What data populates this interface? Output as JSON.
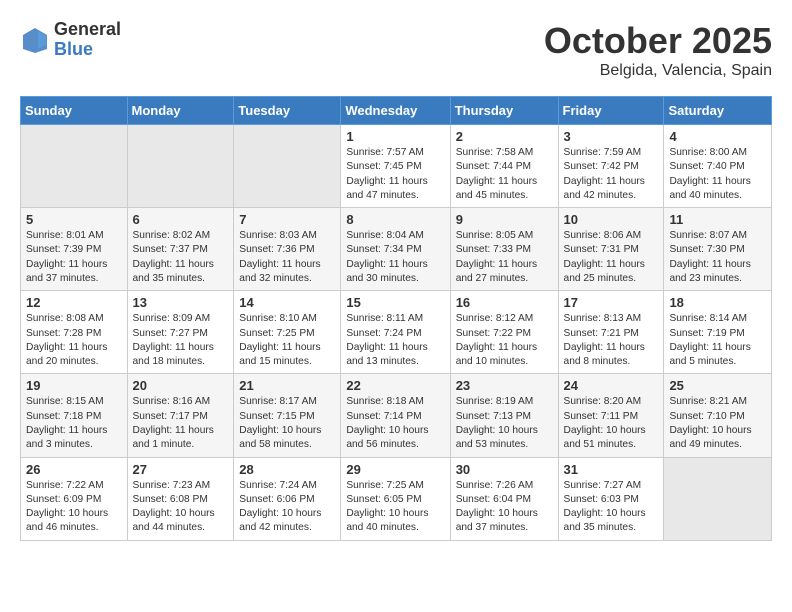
{
  "header": {
    "logo_general": "General",
    "logo_blue": "Blue",
    "month": "October 2025",
    "location": "Belgida, Valencia, Spain"
  },
  "weekdays": [
    "Sunday",
    "Monday",
    "Tuesday",
    "Wednesday",
    "Thursday",
    "Friday",
    "Saturday"
  ],
  "weeks": [
    [
      {
        "day": "",
        "info": ""
      },
      {
        "day": "",
        "info": ""
      },
      {
        "day": "",
        "info": ""
      },
      {
        "day": "1",
        "info": "Sunrise: 7:57 AM\nSunset: 7:45 PM\nDaylight: 11 hours and 47 minutes."
      },
      {
        "day": "2",
        "info": "Sunrise: 7:58 AM\nSunset: 7:44 PM\nDaylight: 11 hours and 45 minutes."
      },
      {
        "day": "3",
        "info": "Sunrise: 7:59 AM\nSunset: 7:42 PM\nDaylight: 11 hours and 42 minutes."
      },
      {
        "day": "4",
        "info": "Sunrise: 8:00 AM\nSunset: 7:40 PM\nDaylight: 11 hours and 40 minutes."
      }
    ],
    [
      {
        "day": "5",
        "info": "Sunrise: 8:01 AM\nSunset: 7:39 PM\nDaylight: 11 hours and 37 minutes."
      },
      {
        "day": "6",
        "info": "Sunrise: 8:02 AM\nSunset: 7:37 PM\nDaylight: 11 hours and 35 minutes."
      },
      {
        "day": "7",
        "info": "Sunrise: 8:03 AM\nSunset: 7:36 PM\nDaylight: 11 hours and 32 minutes."
      },
      {
        "day": "8",
        "info": "Sunrise: 8:04 AM\nSunset: 7:34 PM\nDaylight: 11 hours and 30 minutes."
      },
      {
        "day": "9",
        "info": "Sunrise: 8:05 AM\nSunset: 7:33 PM\nDaylight: 11 hours and 27 minutes."
      },
      {
        "day": "10",
        "info": "Sunrise: 8:06 AM\nSunset: 7:31 PM\nDaylight: 11 hours and 25 minutes."
      },
      {
        "day": "11",
        "info": "Sunrise: 8:07 AM\nSunset: 7:30 PM\nDaylight: 11 hours and 23 minutes."
      }
    ],
    [
      {
        "day": "12",
        "info": "Sunrise: 8:08 AM\nSunset: 7:28 PM\nDaylight: 11 hours and 20 minutes."
      },
      {
        "day": "13",
        "info": "Sunrise: 8:09 AM\nSunset: 7:27 PM\nDaylight: 11 hours and 18 minutes."
      },
      {
        "day": "14",
        "info": "Sunrise: 8:10 AM\nSunset: 7:25 PM\nDaylight: 11 hours and 15 minutes."
      },
      {
        "day": "15",
        "info": "Sunrise: 8:11 AM\nSunset: 7:24 PM\nDaylight: 11 hours and 13 minutes."
      },
      {
        "day": "16",
        "info": "Sunrise: 8:12 AM\nSunset: 7:22 PM\nDaylight: 11 hours and 10 minutes."
      },
      {
        "day": "17",
        "info": "Sunrise: 8:13 AM\nSunset: 7:21 PM\nDaylight: 11 hours and 8 minutes."
      },
      {
        "day": "18",
        "info": "Sunrise: 8:14 AM\nSunset: 7:19 PM\nDaylight: 11 hours and 5 minutes."
      }
    ],
    [
      {
        "day": "19",
        "info": "Sunrise: 8:15 AM\nSunset: 7:18 PM\nDaylight: 11 hours and 3 minutes."
      },
      {
        "day": "20",
        "info": "Sunrise: 8:16 AM\nSunset: 7:17 PM\nDaylight: 11 hours and 1 minute."
      },
      {
        "day": "21",
        "info": "Sunrise: 8:17 AM\nSunset: 7:15 PM\nDaylight: 10 hours and 58 minutes."
      },
      {
        "day": "22",
        "info": "Sunrise: 8:18 AM\nSunset: 7:14 PM\nDaylight: 10 hours and 56 minutes."
      },
      {
        "day": "23",
        "info": "Sunrise: 8:19 AM\nSunset: 7:13 PM\nDaylight: 10 hours and 53 minutes."
      },
      {
        "day": "24",
        "info": "Sunrise: 8:20 AM\nSunset: 7:11 PM\nDaylight: 10 hours and 51 minutes."
      },
      {
        "day": "25",
        "info": "Sunrise: 8:21 AM\nSunset: 7:10 PM\nDaylight: 10 hours and 49 minutes."
      }
    ],
    [
      {
        "day": "26",
        "info": "Sunrise: 7:22 AM\nSunset: 6:09 PM\nDaylight: 10 hours and 46 minutes."
      },
      {
        "day": "27",
        "info": "Sunrise: 7:23 AM\nSunset: 6:08 PM\nDaylight: 10 hours and 44 minutes."
      },
      {
        "day": "28",
        "info": "Sunrise: 7:24 AM\nSunset: 6:06 PM\nDaylight: 10 hours and 42 minutes."
      },
      {
        "day": "29",
        "info": "Sunrise: 7:25 AM\nSunset: 6:05 PM\nDaylight: 10 hours and 40 minutes."
      },
      {
        "day": "30",
        "info": "Sunrise: 7:26 AM\nSunset: 6:04 PM\nDaylight: 10 hours and 37 minutes."
      },
      {
        "day": "31",
        "info": "Sunrise: 7:27 AM\nSunset: 6:03 PM\nDaylight: 10 hours and 35 minutes."
      },
      {
        "day": "",
        "info": ""
      }
    ]
  ]
}
